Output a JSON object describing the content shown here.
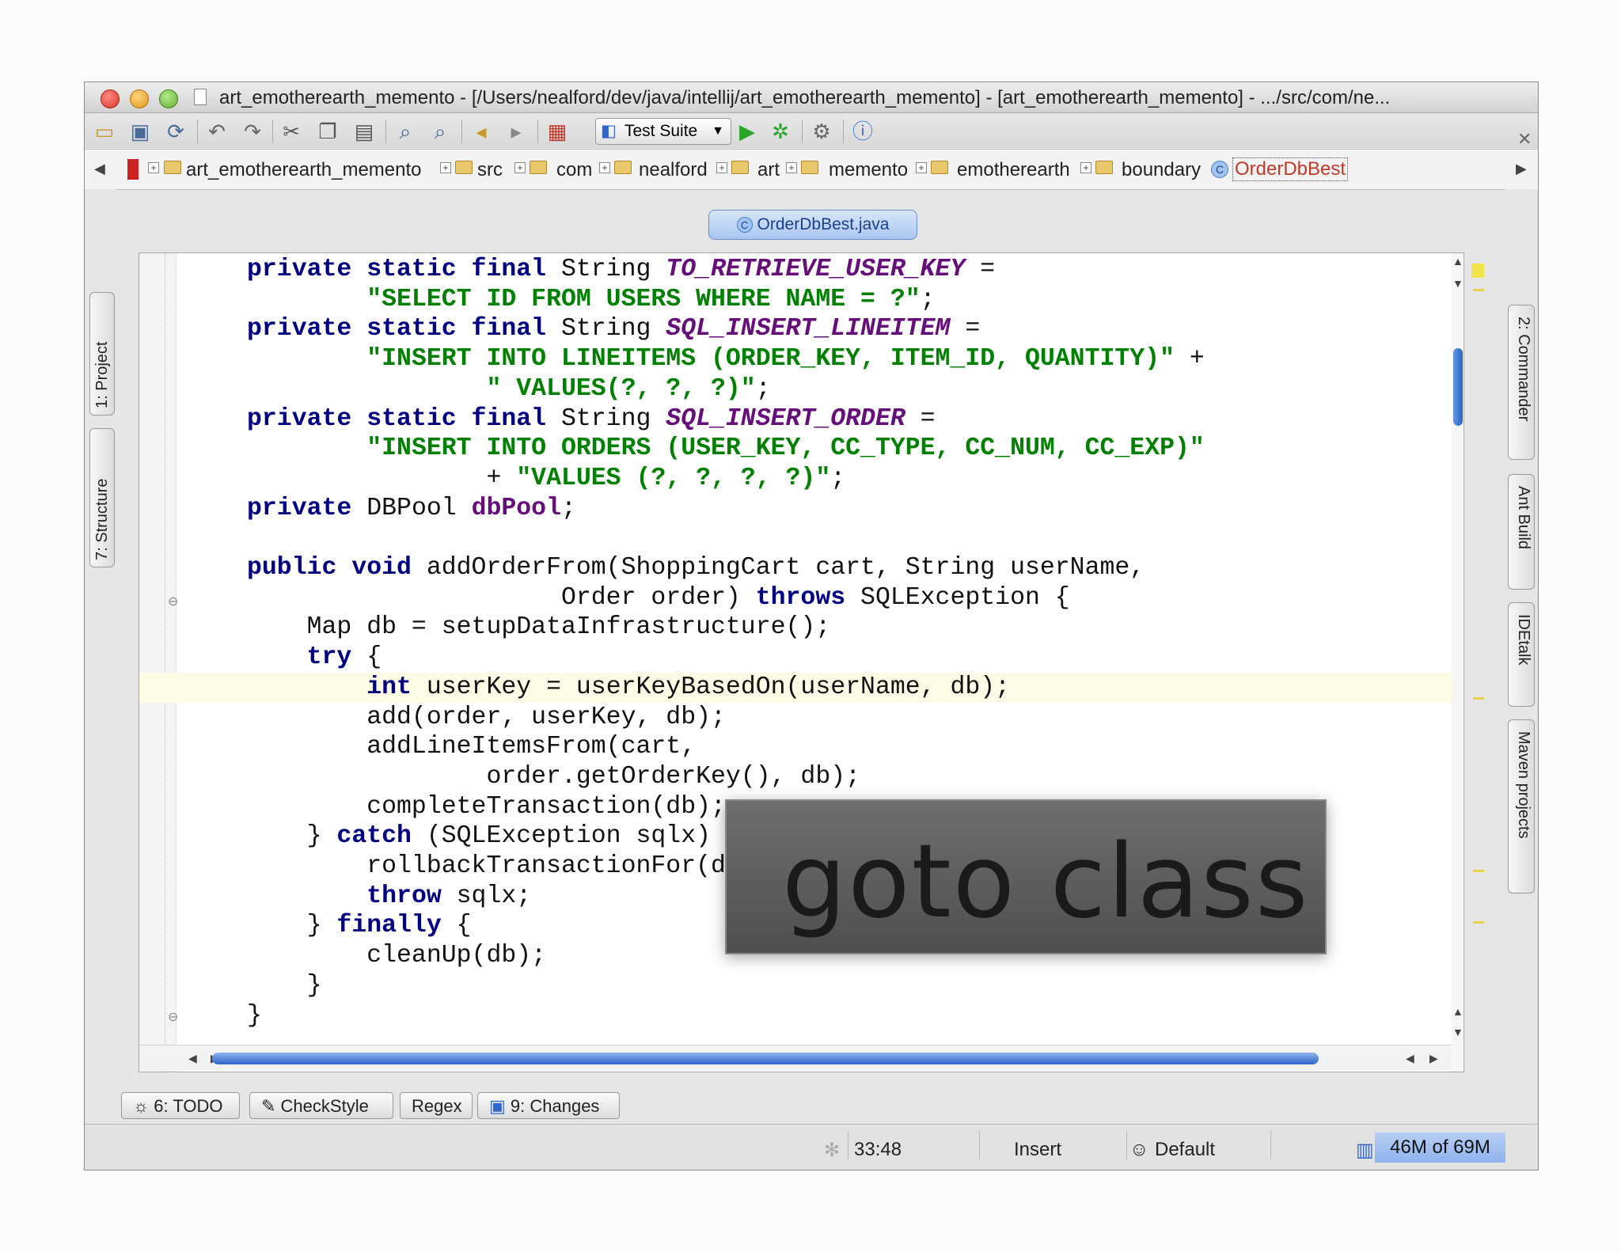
{
  "window": {
    "title": "art_emotherearth_memento - [/Users/nealford/dev/java/intellij/art_emotherearth_memento] - [art_emotherearth_memento] - .../src/com/ne..."
  },
  "toolbar": {
    "run_config": "Test Suite",
    "icons": [
      "open-icon",
      "save-icon",
      "sync-icon",
      "undo-icon",
      "redo-icon",
      "cut-icon",
      "copy-icon",
      "paste-icon",
      "find-icon",
      "replace-icon",
      "back-icon",
      "forward-icon",
      "structure-icon",
      "run-icon",
      "debug-icon",
      "settings-icon",
      "help-icon"
    ]
  },
  "navbar": {
    "crumbs": [
      "art_emotherearth_memento",
      "src",
      "com",
      "nealford",
      "art",
      "memento",
      "emotherearth",
      "boundary",
      "OrderDbBest"
    ]
  },
  "left_tabs": [
    "1: Project",
    "7: Structure"
  ],
  "right_tabs": [
    "2: Commander",
    "Ant Build",
    "IDEtalk",
    "Maven projects"
  ],
  "editor": {
    "tab": "OrderDbBest.java",
    "lines": [
      [
        [
          "kw",
          "private static final "
        ],
        [
          "t",
          "String "
        ],
        [
          "cf",
          "TO_RETRIEVE_USER_KEY"
        ],
        [
          "t",
          " ="
        ]
      ],
      [
        [
          "t",
          "        "
        ],
        [
          "st",
          "\"SELECT ID FROM USERS WHERE NAME = ?\""
        ],
        [
          "t",
          ";"
        ]
      ],
      [
        [
          "kw",
          "private static final "
        ],
        [
          "t",
          "String "
        ],
        [
          "cf",
          "SQL_INSERT_LINEITEM"
        ],
        [
          "t",
          " ="
        ]
      ],
      [
        [
          "t",
          "        "
        ],
        [
          "st",
          "\"INSERT INTO LINEITEMS (ORDER_KEY, ITEM_ID, QUANTITY)\""
        ],
        [
          "t",
          " +"
        ]
      ],
      [
        [
          "t",
          "                "
        ],
        [
          "st",
          "\" VALUES(?, ?, ?)\""
        ],
        [
          "t",
          ";"
        ]
      ],
      [
        [
          "kw",
          "private static final "
        ],
        [
          "t",
          "String "
        ],
        [
          "cf",
          "SQL_INSERT_ORDER"
        ],
        [
          "t",
          " ="
        ]
      ],
      [
        [
          "t",
          "        "
        ],
        [
          "st",
          "\"INSERT INTO ORDERS (USER_KEY, CC_TYPE, CC_NUM, CC_EXP)\""
        ]
      ],
      [
        [
          "t",
          "                + "
        ],
        [
          "st",
          "\"VALUES (?, ?, ?, ?)\""
        ],
        [
          "t",
          ";"
        ]
      ],
      [
        [
          "kw",
          "private "
        ],
        [
          "t",
          "DBPool "
        ],
        [
          "fd",
          "dbPool"
        ],
        [
          "t",
          ";"
        ]
      ],
      [
        [
          "t",
          ""
        ]
      ],
      [
        [
          "kw",
          "public void "
        ],
        [
          "t",
          "addOrderFrom(ShoppingCart cart, String userName,"
        ]
      ],
      [
        [
          "t",
          "                     Order order) "
        ],
        [
          "kw",
          "throws "
        ],
        [
          "t",
          "SQLException {"
        ]
      ],
      [
        [
          "t",
          "    Map db = setupDataInfrastructure();"
        ]
      ],
      [
        [
          "t",
          "    "
        ],
        [
          "kw",
          "try "
        ],
        [
          "t",
          "{"
        ]
      ],
      [
        [
          "t",
          "        "
        ],
        [
          "kw",
          "int "
        ],
        [
          "t",
          "userKey = userKeyBasedOn(userName, db);"
        ]
      ],
      [
        [
          "t",
          "        add(order, userKey, db);"
        ]
      ],
      [
        [
          "t",
          "        addLineItemsFrom(cart,"
        ]
      ],
      [
        [
          "t",
          "                order.getOrderKey(), db);"
        ]
      ],
      [
        [
          "t",
          "        completeTransaction(db);"
        ]
      ],
      [
        [
          "t",
          "    } "
        ],
        [
          "kw",
          "catch "
        ],
        [
          "t",
          "(SQLException sqlx) {"
        ]
      ],
      [
        [
          "t",
          "        rollbackTransactionFor(db);"
        ]
      ],
      [
        [
          "t",
          "        "
        ],
        [
          "kw",
          "throw "
        ],
        [
          "t",
          "sqlx;"
        ]
      ],
      [
        [
          "t",
          "    } "
        ],
        [
          "kw",
          "finally "
        ],
        [
          "t",
          "{"
        ]
      ],
      [
        [
          "t",
          "        cleanUp(db);"
        ]
      ],
      [
        [
          "t",
          "    }"
        ]
      ],
      [
        [
          "t",
          "}"
        ]
      ]
    ],
    "highlight_line": 14
  },
  "overlay": {
    "text": "goto class"
  },
  "bottom_tabs": {
    "todo": "6: TODO",
    "checkstyle": "CheckStyle",
    "regex": "Regex",
    "changes": "9: Changes"
  },
  "status": {
    "position": "33:48",
    "mode": "Insert",
    "profile": "Default",
    "memory": "46M of 69M"
  },
  "colors": {
    "keyword": "#000080",
    "string": "#008000",
    "constant": "#660e7a",
    "highlight_line": "#fbfbe6",
    "memory_bar": "#9fbff0"
  }
}
